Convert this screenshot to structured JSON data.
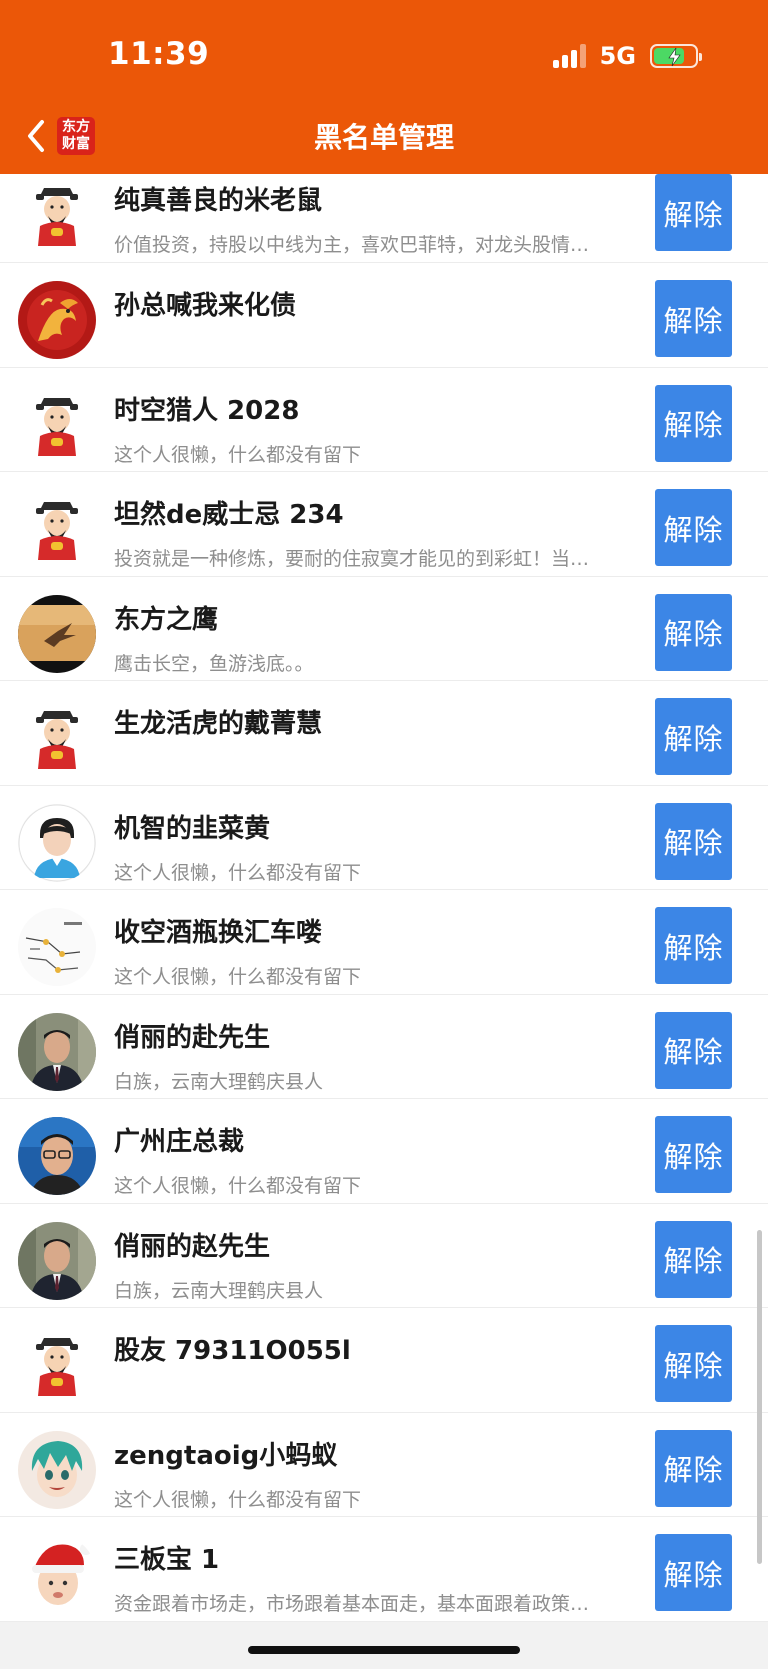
{
  "status": {
    "time": "11:39",
    "network": "5G",
    "battery_level": 0.75,
    "signal_bars": 3
  },
  "header": {
    "title": "黑名单管理",
    "logo_text": "东方\n财富",
    "background": "#eb5708"
  },
  "accent": {
    "button_color": "#3c86e6"
  },
  "list": {
    "items": [
      {
        "name": "纯真善良的米老鼠",
        "desc": "价值投资，持股以中线为主，喜欢巴菲特，对龙头股情…",
        "avatar": "caishen",
        "button": "解除"
      },
      {
        "name": "孙总喊我来化债",
        "desc": "",
        "avatar": "dragon",
        "button": "解除"
      },
      {
        "name": "时空猎人 2028",
        "desc": "这个人很懒，什么都没有留下",
        "avatar": "caishen",
        "button": "解除"
      },
      {
        "name": "坦然de威士忌 234",
        "desc": "投资就是一种修炼，要耐的住寂寞才能见的到彩虹！当…",
        "avatar": "caishen",
        "button": "解除"
      },
      {
        "name": "东方之鹰",
        "desc": "鹰击长空，鱼游浅底。。",
        "avatar": "eagle",
        "button": "解除"
      },
      {
        "name": "生龙活虎的戴菁慧",
        "desc": "",
        "avatar": "caishen",
        "button": "解除"
      },
      {
        "name": "机智的韭菜黄",
        "desc": "这个人很懒，什么都没有留下",
        "avatar": "default-person",
        "button": "解除"
      },
      {
        "name": "收空酒瓶换汇车喽",
        "desc": "这个人很懒，什么都没有留下",
        "avatar": "sketch-chart",
        "button": "解除"
      },
      {
        "name": "俏丽的赴先生",
        "desc": "白族，云南大理鹤庆县人",
        "avatar": "man-portrait",
        "button": "解除"
      },
      {
        "name": "广州庄总裁",
        "desc": "这个人很懒，什么都没有留下",
        "avatar": "man-glasses",
        "button": "解除"
      },
      {
        "name": "俏丽的赵先生",
        "desc": "白族，云南大理鹤庆县人",
        "avatar": "man-portrait",
        "button": "解除"
      },
      {
        "name": "股友 79311O055l",
        "desc": "",
        "avatar": "caishen",
        "button": "解除"
      },
      {
        "name": "zengtaoig小蚂蚁",
        "desc": "这个人很懒，什么都没有留下",
        "avatar": "anime-boy",
        "button": "解除"
      },
      {
        "name": "三板宝 1",
        "desc": "资金跟着市场走，市场跟着基本面走，基本面跟着政策…",
        "avatar": "santa-baby",
        "button": "解除"
      }
    ]
  }
}
